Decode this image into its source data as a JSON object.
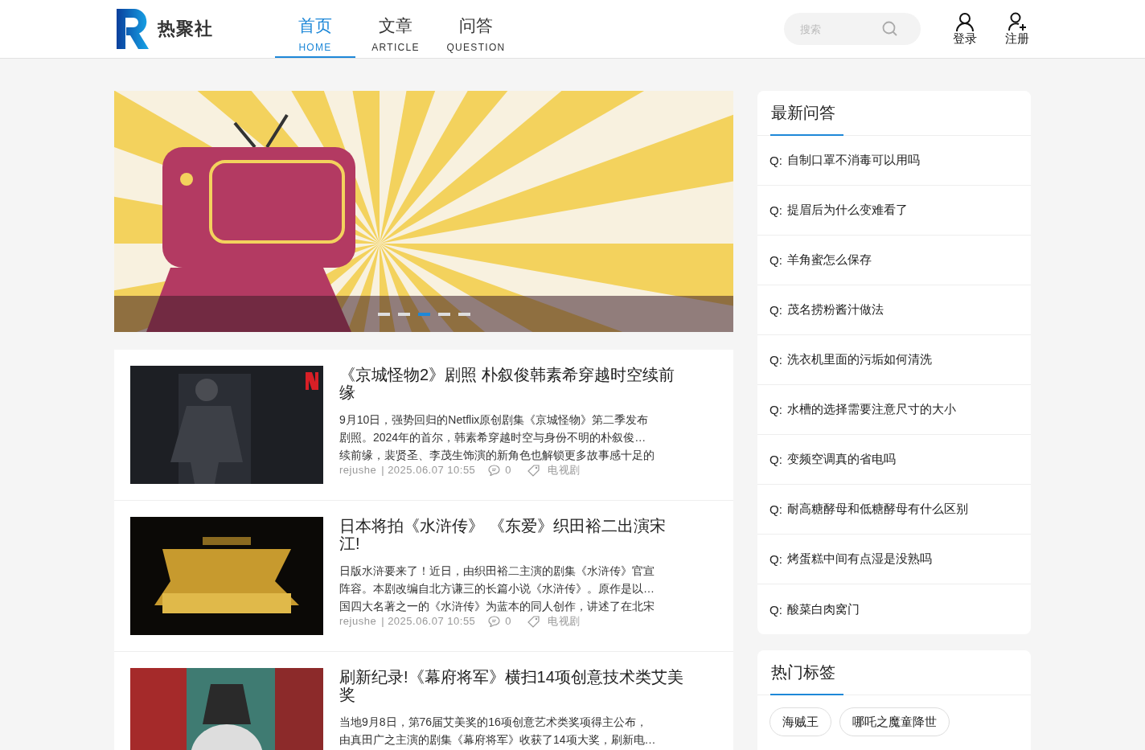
{
  "header": {
    "logo_text": "热聚社",
    "nav": [
      {
        "label": "首页",
        "sublabel": "HOME",
        "selected": true
      },
      {
        "label": "文章",
        "sublabel": "ARTICLE",
        "selected": false
      },
      {
        "label": "问答",
        "sublabel": "QUESTION",
        "selected": false
      }
    ],
    "search": {
      "placeholder": "搜索"
    },
    "actions": [
      {
        "kind": "login",
        "label": "登录"
      },
      {
        "kind": "register",
        "label": "注册"
      }
    ]
  },
  "banner": {
    "kind": "picture",
    "dots": [
      {
        "selected": false
      },
      {
        "selected": false
      },
      {
        "selected": true
      },
      {
        "selected": false
      },
      {
        "selected": false
      }
    ]
  },
  "articles": [
    {
      "title": "《京城怪物2》剧照 朴叙俊韩素希穿越时空续前缘",
      "excerpt": [
        "9月10日，强势回归的Netflix原创剧集《京城怪物》第二季发布",
        "剧照。2024年的首尔，韩素希穿越时空与身份不明的朴叙俊…",
        "续前缘，裴贤圣、李茂生饰演的新角色也解锁更多故事感十足的"
      ],
      "author": "rejushe",
      "date": "| 2025.06.07 10:55",
      "comments": "0",
      "tag": "电视剧"
    },
    {
      "title": "日本将拍《水浒传》 《东爱》织田裕二出演宋江!",
      "excerpt": [
        "日版水浒要来了！近日，由织田裕二主演的剧集《水浒传》官宣",
        "阵容。本剧改编自北方谦三的长篇小说《水浒传》。原作是以…",
        "国四大名著之一的《水浒传》为蓝本的同人创作，讲述了在北宋"
      ],
      "author": "rejushe",
      "date": "| 2025.06.07 10:55",
      "comments": "0",
      "tag": "电视剧"
    },
    {
      "title": "刷新纪录!《幕府将军》横扫14项创意技术类艾美奖",
      "excerpt": [
        "当地9月8日，第76届艾美奖的16项创意艺术类奖项得主公布，",
        "由真田广之主演的剧集《幕府将军》收获了14项大奖，刷新电…"
      ]
    }
  ],
  "qa": {
    "title": "最新问答",
    "questions": [
      {
        "prefix": "Q:",
        "text": "自制口罩不消毒可以用吗"
      },
      {
        "prefix": "Q:",
        "text": "提眉后为什么变难看了"
      },
      {
        "prefix": "Q:",
        "text": "羊角蜜怎么保存"
      },
      {
        "prefix": "Q:",
        "text": "茂名捞粉酱汁做法"
      },
      {
        "prefix": "Q:",
        "text": "洗衣机里面的污垢如何清洗"
      },
      {
        "prefix": "Q:",
        "text": "水槽的选择需要注意尺寸的大小"
      },
      {
        "prefix": "Q:",
        "text": "变频空调真的省电吗"
      },
      {
        "prefix": "Q:",
        "text": "耐高糖酵母和低糖酵母有什么区别"
      },
      {
        "prefix": "Q:",
        "text": "烤蛋糕中间有点湿是没熟吗"
      },
      {
        "prefix": "Q:",
        "text": "酸菜白肉窝门"
      }
    ]
  },
  "tags": {
    "title": "热门标签",
    "items": [
      "海贼王",
      "哪吒之魔童降世"
    ]
  }
}
